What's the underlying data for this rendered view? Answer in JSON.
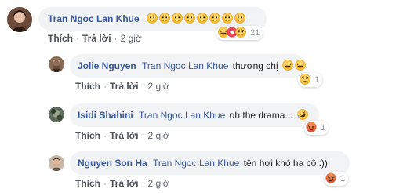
{
  "colors": {
    "link": "#385898",
    "bubble": "#f2f3f5",
    "meta": "#606770"
  },
  "comments": [
    {
      "author": "Tran Ngoc Lan Khue",
      "mention": "",
      "text": "",
      "emojis": [
        "sad",
        "sad",
        "sad",
        "sad",
        "sad",
        "sad",
        "sad",
        "sad"
      ],
      "like": "Thích",
      "reply": "Trả lời",
      "time": "2 giờ",
      "reactions": [
        "haha",
        "love",
        "sad"
      ],
      "reaction_count": "21"
    },
    {
      "author": "Jolie Nguyen",
      "mention": "Tran Ngoc Lan Khue",
      "text": "thương chị",
      "emojis": [
        "haha",
        "haha"
      ],
      "like": "Thích",
      "reply": "Trả lời",
      "time": "2 giờ",
      "reactions": [
        "sad"
      ],
      "reaction_count": "1"
    },
    {
      "author": "Isidi Shahini",
      "mention": "Tran Ngoc Lan Khue",
      "text": "oh the drama...",
      "emojis": [
        "rofl"
      ],
      "like": "Thích",
      "reply": "Trả lời",
      "time": "2 giờ",
      "reactions": [
        "angry"
      ],
      "reaction_count": "1"
    },
    {
      "author": "Nguyen Son Ha",
      "mention": "Tran Ngoc Lan Khue",
      "text": "tên hơi khó ha cô :))",
      "emojis": [],
      "like": "Thích",
      "reply": "Trả lời",
      "time": "2 giờ",
      "reactions": [
        "angry"
      ],
      "reaction_count": "1"
    }
  ]
}
